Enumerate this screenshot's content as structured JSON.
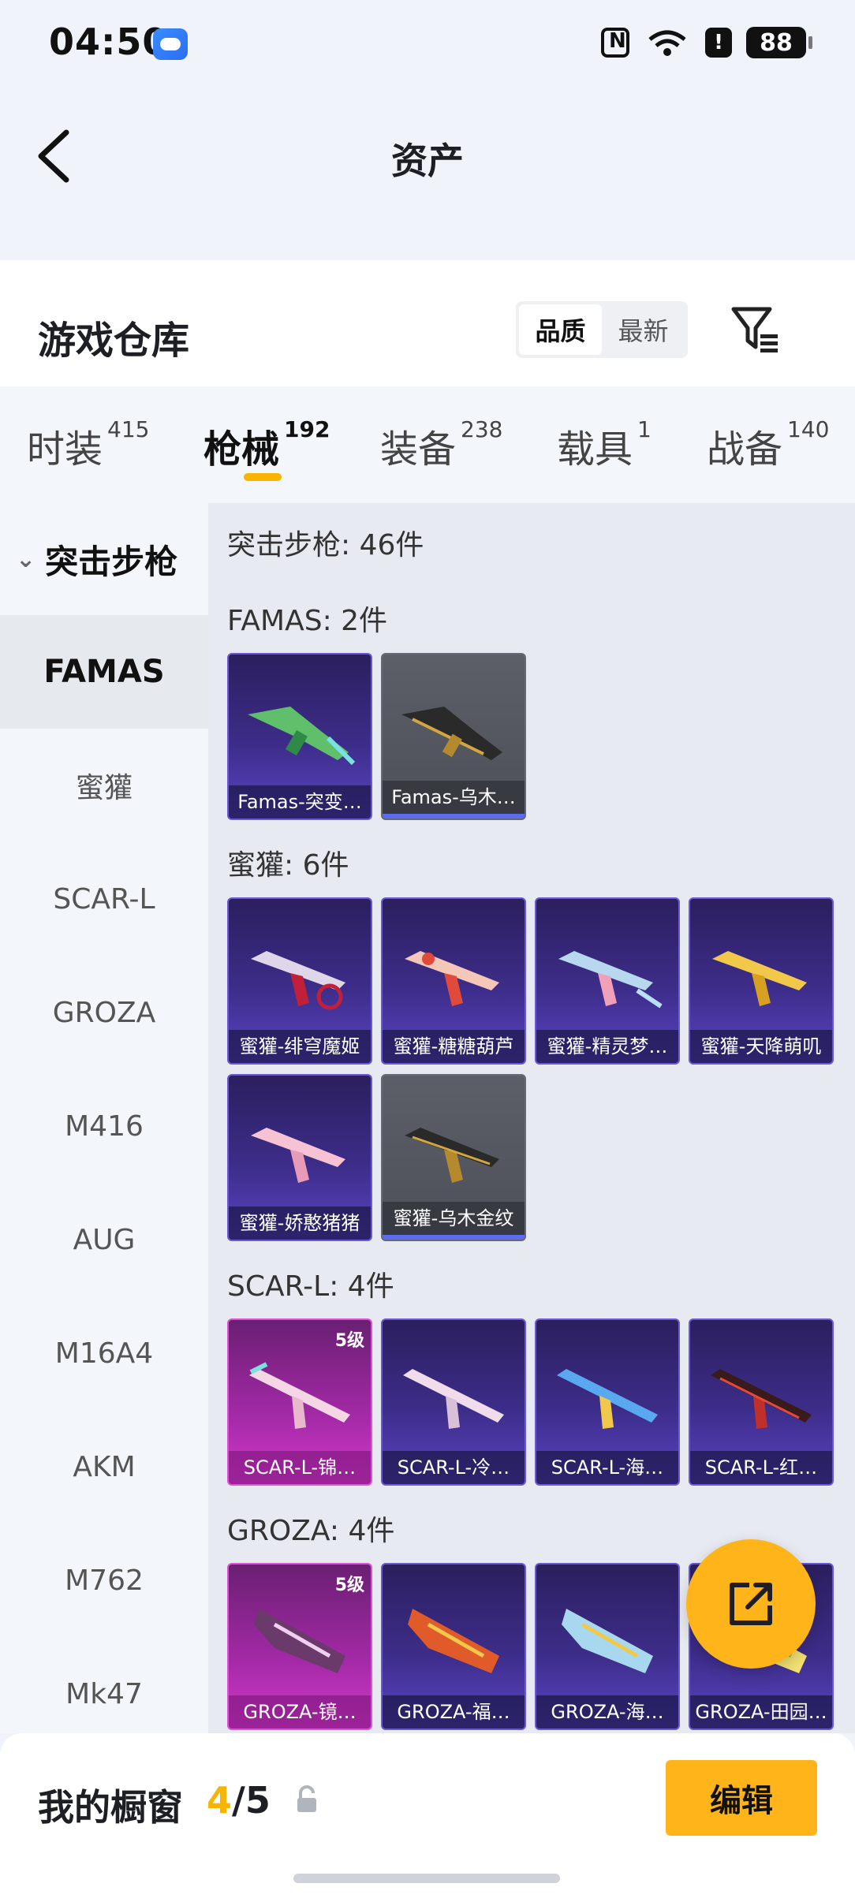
{
  "status_bar": {
    "time": "04:50",
    "battery": "88",
    "alert": "!"
  },
  "header": {
    "title": "资产"
  },
  "warehouse": {
    "title": "游戏仓库",
    "sort_options": [
      "品质",
      "最新"
    ],
    "active_sort": "品质"
  },
  "categories": [
    {
      "label": "时装",
      "count": "415"
    },
    {
      "label": "枪械",
      "count": "192",
      "active": true
    },
    {
      "label": "装备",
      "count": "238"
    },
    {
      "label": "载具",
      "count": "1"
    },
    {
      "label": "战备",
      "count": "140"
    }
  ],
  "side_nav": {
    "group": "突击步枪",
    "items": [
      "FAMAS",
      "蜜獾",
      "SCAR-L",
      "GROZA",
      "M416",
      "AUG",
      "M16A4",
      "AKM",
      "M762",
      "Mk47"
    ],
    "active": "FAMAS"
  },
  "content": {
    "section_total": "突击步枪: 46件",
    "groups": [
      {
        "title": "FAMAS: 2件",
        "items": [
          {
            "name": "Famas-突变…",
            "style": "purple"
          },
          {
            "name": "Famas-乌木…",
            "style": "gray"
          }
        ]
      },
      {
        "title": "蜜獾: 6件",
        "items": [
          {
            "name": "蜜獾-绯穹魔姬",
            "style": "purple"
          },
          {
            "name": "蜜獾-糖糖葫芦",
            "style": "purple"
          },
          {
            "name": "蜜獾-精灵梦…",
            "style": "purple"
          },
          {
            "name": "蜜獾-天降萌叽",
            "style": "purple"
          },
          {
            "name": "蜜獾-娇憨猪猪",
            "style": "purple"
          },
          {
            "name": "蜜獾-乌木金纹",
            "style": "gray"
          }
        ]
      },
      {
        "title": "SCAR-L: 4件",
        "items": [
          {
            "name": "SCAR-L-锦…",
            "style": "pink",
            "level": "5级"
          },
          {
            "name": "SCAR-L-冷…",
            "style": "purple"
          },
          {
            "name": "SCAR-L-海…",
            "style": "purple"
          },
          {
            "name": "SCAR-L-红…",
            "style": "purple"
          }
        ]
      },
      {
        "title": "GROZA: 4件",
        "items": [
          {
            "name": "GROZA-镜…",
            "style": "pink",
            "level": "5级"
          },
          {
            "name": "GROZA-福…",
            "style": "purple"
          },
          {
            "name": "GROZA-海…",
            "style": "purple"
          },
          {
            "name": "GROZA-田园…",
            "style": "purple"
          }
        ]
      }
    ]
  },
  "bottom_bar": {
    "label": "我的橱窗",
    "current": "4",
    "separator_total": "/5",
    "edit_label": "编辑"
  },
  "colors": {
    "accent": "#ffb51a",
    "tab_indicator": "#f7b500",
    "purple_tile": "#3d2d8a",
    "pink_tile": "#d33ac9"
  }
}
